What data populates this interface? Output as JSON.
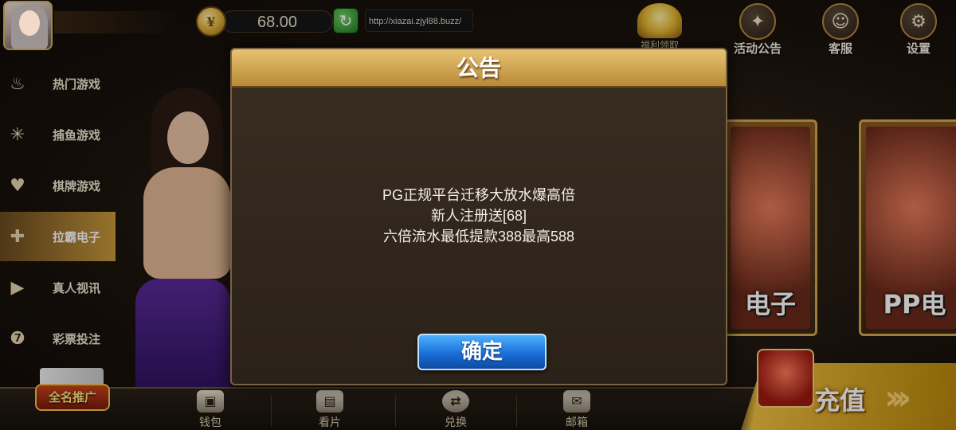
{
  "balance": {
    "value": "68.00"
  },
  "url": {
    "text": "http://xiazai.zjyl88.buzz/"
  },
  "top_menu": [
    {
      "label": "福利领取",
      "icon": "gold-pile-icon"
    },
    {
      "label": "活动公告",
      "icon": "announcement-icon"
    },
    {
      "label": "客服",
      "icon": "customer-service-icon"
    },
    {
      "label": "设置",
      "icon": "settings-icon"
    }
  ],
  "sidebar": {
    "items": [
      {
        "label": "热门游戏",
        "icon": "flame-icon"
      },
      {
        "label": "捕鱼游戏",
        "icon": "web-icon"
      },
      {
        "label": "棋牌游戏",
        "icon": "card-icon"
      },
      {
        "label": "拉霸电子",
        "icon": "gamepad-icon",
        "active": true
      },
      {
        "label": "真人视讯",
        "icon": "video-icon"
      },
      {
        "label": "彩票投注",
        "icon": "lottery-ball-icon"
      }
    ]
  },
  "cards": [
    {
      "label": "电子"
    },
    {
      "label": "PP电"
    }
  ],
  "bottom_bar": {
    "promo_label": "全名推广",
    "items": [
      {
        "label": "钱包",
        "icon": "wallet-icon"
      },
      {
        "label": "看片",
        "icon": "clapperboard-icon"
      },
      {
        "label": "兑换",
        "icon": "exchange-icon"
      },
      {
        "label": "邮箱",
        "icon": "mail-icon"
      }
    ],
    "recharge_label": "充值"
  },
  "modal": {
    "title": "公告",
    "lines": [
      "PG正规平台迁移大放水爆高倍",
      "新人注册送[68]",
      "六倍流水最低提款388最高588"
    ],
    "confirm_label": "确定"
  },
  "colors": {
    "accent_gold": "#d2a84a",
    "button_blue": "#1a6fd8",
    "sidebar_active": "#c99a3c"
  }
}
